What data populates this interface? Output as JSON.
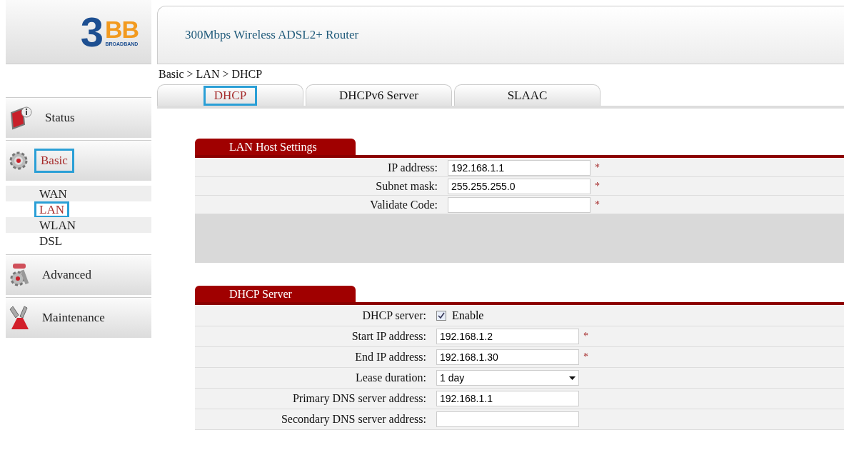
{
  "logo": {
    "numeral": "3",
    "letters": "BB",
    "tagline": "BROADBAND"
  },
  "header": {
    "title": "300Mbps Wireless ADSL2+ Router"
  },
  "breadcrumb": "Basic > LAN > DHCP",
  "tabs": [
    {
      "label": "DHCP",
      "selected": true,
      "highlighted": true
    },
    {
      "label": "DHCPv6 Server",
      "selected": false,
      "highlighted": false
    },
    {
      "label": "SLAAC",
      "selected": false,
      "highlighted": false
    }
  ],
  "sidebar": {
    "items": [
      {
        "label": "Status",
        "selected": false,
        "highlighted": false
      },
      {
        "label": "Basic",
        "selected": true,
        "highlighted": true,
        "children": [
          {
            "label": "WAN",
            "selected": false,
            "highlighted": false
          },
          {
            "label": "LAN",
            "selected": true,
            "highlighted": true
          },
          {
            "label": "WLAN",
            "selected": false,
            "highlighted": false
          },
          {
            "label": "DSL",
            "selected": false,
            "highlighted": false
          }
        ]
      },
      {
        "label": "Advanced",
        "selected": false,
        "highlighted": false
      },
      {
        "label": "Maintenance",
        "selected": false,
        "highlighted": false
      }
    ]
  },
  "sections": [
    {
      "title": "LAN Host Settings",
      "footer_band": true,
      "rows": [
        {
          "kind": "text",
          "label": "IP address:",
          "value": "192.168.1.1",
          "required_mark": "*"
        },
        {
          "kind": "text",
          "label": "Subnet mask:",
          "value": "255.255.255.0",
          "required_mark": "*"
        },
        {
          "kind": "text",
          "label": "Validate Code:",
          "value": "",
          "required_mark": "*"
        }
      ]
    },
    {
      "title": "DHCP Server",
      "footer_band": false,
      "rows": [
        {
          "kind": "checkbox",
          "label": "DHCP server:",
          "option": "Enable",
          "checked": true
        },
        {
          "kind": "text",
          "label": "Start IP address:",
          "value": "192.168.1.2",
          "required_mark": "*"
        },
        {
          "kind": "text",
          "label": "End IP address:",
          "value": "192.168.1.30",
          "required_mark": "*"
        },
        {
          "kind": "select",
          "label": "Lease duration:",
          "value": "1 day"
        },
        {
          "kind": "text",
          "label": "Primary DNS server address:",
          "value": "192.168.1.1"
        },
        {
          "kind": "text",
          "label": "Secondary DNS server address:",
          "value": ""
        }
      ]
    }
  ]
}
